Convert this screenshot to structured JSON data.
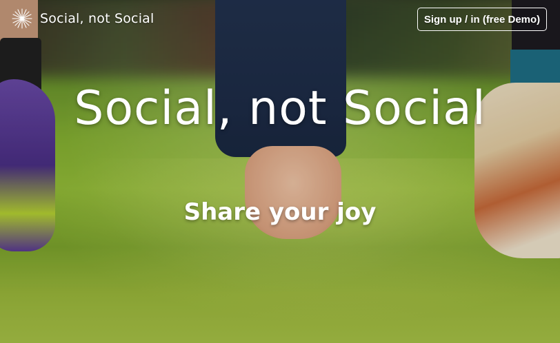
{
  "navbar": {
    "brand_text": "Social, not Social",
    "brand_icon": "sparkle-burst-icon",
    "signup_label": "Sign up / in (free Demo)"
  },
  "hero": {
    "title": "Social, not Social",
    "subtitle": "Share your joy"
  },
  "colors": {
    "text": "#ffffff",
    "button_border": "#ffffff",
    "grass": "#86b232"
  }
}
